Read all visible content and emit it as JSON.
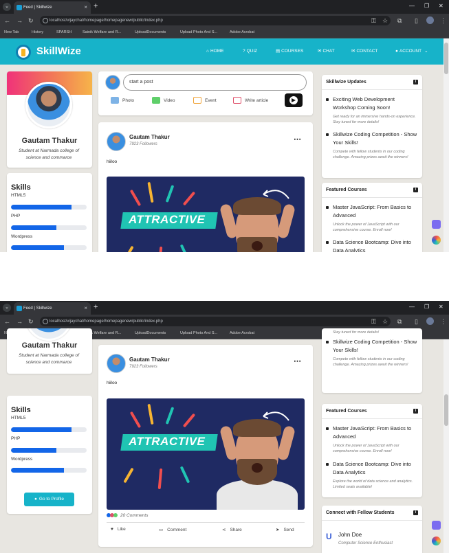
{
  "browser": {
    "tab_title": "Feed | Skillwize",
    "tab_close": "×",
    "new_tab": "+",
    "url": "localhost/vijaychat/homepage/homepagenew/public/index.php",
    "bookmarks": [
      "New Tab",
      "History",
      "SPARSH",
      "Sainik Welfare and R...",
      "UploadDocuments",
      "Upload Photo And S...",
      "Adobe Acrobat"
    ]
  },
  "navbar": {
    "brand": "SkillWize",
    "links": [
      "HOME",
      "QUIZ",
      "COURSES",
      "CHAT",
      "CONTACT",
      "ACCOUNT"
    ]
  },
  "profile": {
    "name": "Gautam Thakur",
    "subtitle": "Student at Narmada college of science and commarce",
    "skills_heading": "Skills",
    "skills": [
      {
        "label": "HTML5",
        "level": 0.8
      },
      {
        "label": "PHP",
        "level": 0.6
      },
      {
        "label": "Wordpress",
        "level": 0.7
      }
    ],
    "profile_button": "Go to Profile"
  },
  "composer": {
    "placeholder": "start a post",
    "actions": [
      "Photo",
      "Video",
      "Event",
      "Write article"
    ]
  },
  "post": {
    "author": "Gautam Thakur",
    "followers": "7923 Followers",
    "text": "hiiloo",
    "image_caption": "ATTRACTIVE",
    "comments": "20 Comments",
    "actions": [
      "Like",
      "Comment",
      "Share",
      "Send"
    ]
  },
  "updates": {
    "heading": "Skillwize Updates",
    "info_badge": "i",
    "items": [
      {
        "title": "Exciting Web Development Workshop Coming Soon!",
        "desc": "Get ready for an immersive hands-on experience. Stay tuned for more details!"
      },
      {
        "title": "Skillwize Coding Competition - Show Your Skills!",
        "desc": "Compete with fellow students in our coding challenge. Amazing prizes await the winners!"
      }
    ]
  },
  "courses": {
    "heading": "Featured Courses",
    "info_badge": "i",
    "items": [
      {
        "title": "Master JavaScript: From Basics to Advanced",
        "desc": "Unlock the power of JavaScript with our comprehensive course. Enroll now!"
      },
      {
        "title": "Data Science Bootcamp: Dive into Data Analytics",
        "desc": "Explore the world of data science and analytics. Limited seats available!"
      }
    ]
  },
  "connect": {
    "heading": "Connect with Fellow Students",
    "info_badge": "i",
    "person": {
      "name": "John Doe",
      "role": "Computer Science Enthusiast"
    }
  },
  "colors": {
    "accent": "#17b3c9",
    "skill_bar": "#1366e8",
    "browser_dark": "#202124"
  }
}
